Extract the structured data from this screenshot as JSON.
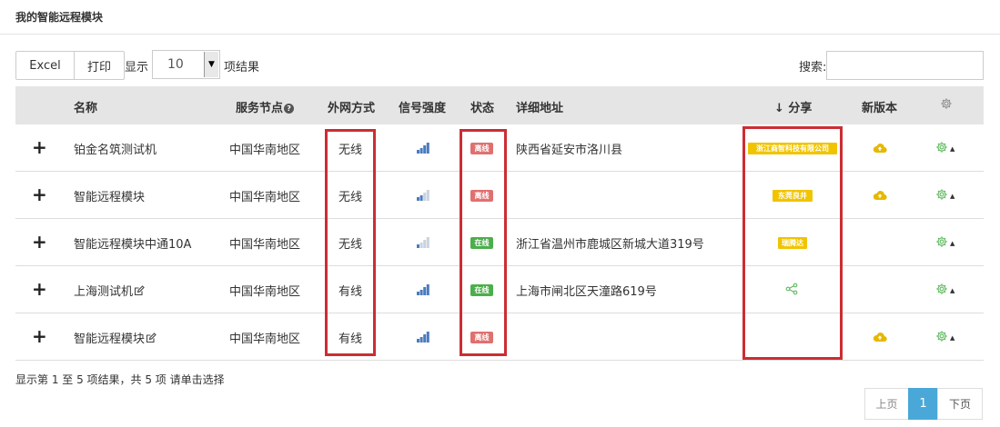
{
  "page": {
    "title": "我的智能远程模块"
  },
  "toolbar": {
    "excel_label": "Excel",
    "print_label": "打印",
    "show_label": "显示",
    "page_size": "10",
    "results_label": "项结果",
    "search_label": "搜索:",
    "search_value": ""
  },
  "table": {
    "headers": {
      "name": "名称",
      "node": "服务节点",
      "network": "外网方式",
      "signal": "信号强度",
      "status": "状态",
      "address": "详细地址",
      "share": "↓ 分享",
      "new_version": "新版本"
    },
    "rows": [
      {
        "name": "铂金名筑测试机",
        "node": "中国华南地区",
        "network": "无线",
        "signal_level": 4,
        "status": "离线",
        "status_state": "offline",
        "address": "陕西省延安市洛川县",
        "share": "浙江商智科技有限公司",
        "editable": false,
        "has_upgrade": true,
        "has_settings": true
      },
      {
        "name": "智能远程模块",
        "node": "中国华南地区",
        "network": "无线",
        "signal_level": 2,
        "status": "离线",
        "status_state": "offline",
        "address": "",
        "share": "东莞良井",
        "editable": false,
        "has_upgrade": true,
        "has_settings": true
      },
      {
        "name": "智能远程模块中通10A",
        "node": "中国华南地区",
        "network": "无线",
        "signal_level": 1,
        "status": "在线",
        "status_state": "online",
        "address": "浙江省温州市鹿城区新城大道319号",
        "share": "瑞腾达",
        "editable": false,
        "has_upgrade": false,
        "has_settings": true
      },
      {
        "name": "上海测试机",
        "node": "中国华南地区",
        "network": "有线",
        "signal_level": 4,
        "status": "在线",
        "status_state": "online",
        "address": "上海市闸北区天潼路619号",
        "share": "",
        "share_icon": "share-icon",
        "editable": true,
        "has_upgrade": false,
        "has_settings": true
      },
      {
        "name": "智能远程模块",
        "node": "中国华南地区",
        "network": "有线",
        "signal_level": 4,
        "status": "离线",
        "status_state": "offline",
        "address": "",
        "share": "",
        "editable": true,
        "has_upgrade": true,
        "has_settings": true
      }
    ]
  },
  "footer": {
    "info": "显示第 1 至 5 项结果，共 5 项   请单击选择",
    "prev": "上页",
    "current": "1",
    "next": "下页"
  },
  "colors": {
    "accent": "#4aa8d8",
    "online": "#4cae4c",
    "offline": "#e07070",
    "share": "#f0c400",
    "highlight": "#cc2d33",
    "upgrade": "#e6b800",
    "settings": "#5cb85c",
    "signal": "#4a7bbf"
  },
  "icons": {
    "expand": "plus-icon",
    "edit": "edit-icon",
    "signal": "signal-bars-icon",
    "upgrade": "cloud-upload-icon",
    "settings": "gear-icon",
    "help": "help-icon",
    "share": "share-icon"
  }
}
